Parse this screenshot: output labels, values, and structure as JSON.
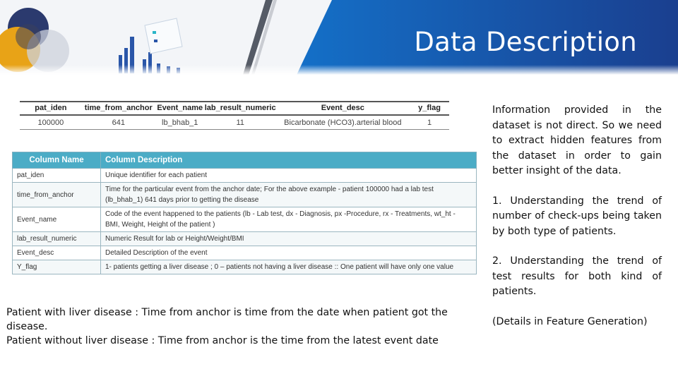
{
  "slide": {
    "title": "Data Description"
  },
  "sample_table": {
    "headers": [
      "pat_iden",
      "time_from_anchor",
      "Event_name",
      "lab_result_numeric",
      "Event_desc",
      "y_flag"
    ],
    "row": [
      "100000",
      "641",
      "lb_bhab_1",
      "11",
      "Bicarbonate (HCO3).arterial blood",
      "1"
    ]
  },
  "desc_table": {
    "headers": [
      "Column Name",
      "Column Description"
    ],
    "rows": [
      {
        "name": "pat_iden",
        "desc": "Unique identifier for each patient"
      },
      {
        "name": "time_from_anchor",
        "desc": "Time for the particular event from the anchor date; For the above example - patient 100000 had a lab test (lb_bhab_1) 641 days prior to getting the disease"
      },
      {
        "name": "Event_name",
        "desc": "Code of the event happened to the patients (lb - Lab test, dx - Diagnosis, px -Procedure, rx - Treatments, wt_ht - BMI, Weight, Height of the patient )"
      },
      {
        "name": "lab_result_numeric",
        "desc": "Numeric Result for lab or Height/Weight/BMI"
      },
      {
        "name": "Event_desc",
        "desc": "Detailed Description of the event"
      },
      {
        "name": "Y_flag",
        "desc": "1- patients getting a liver disease ; 0 – patients not having a liver disease :: One patient will have only one value"
      }
    ]
  },
  "notes": {
    "line1": "Patient with liver disease : Time from anchor is time from the date when patient got the disease.",
    "line2": "Patient without liver disease : Time from anchor is the time from the latest event date"
  },
  "right_panel": {
    "intro": "Information provided in the dataset is not direct. So we need to extract hidden features from the dataset in order to gain better insight of the data.",
    "point1": "1. Understanding the trend of number of check-ups being taken by both type of patients.",
    "point2": "2. Understanding the trend of test results for both kind of patients.",
    "details": "(Details in Feature Generation)"
  },
  "colors": {
    "header_blue": "#1a4f9c",
    "table_header": "#4bacc6",
    "circle_navy": "#2b3a6e",
    "circle_gold": "#e8a317"
  }
}
